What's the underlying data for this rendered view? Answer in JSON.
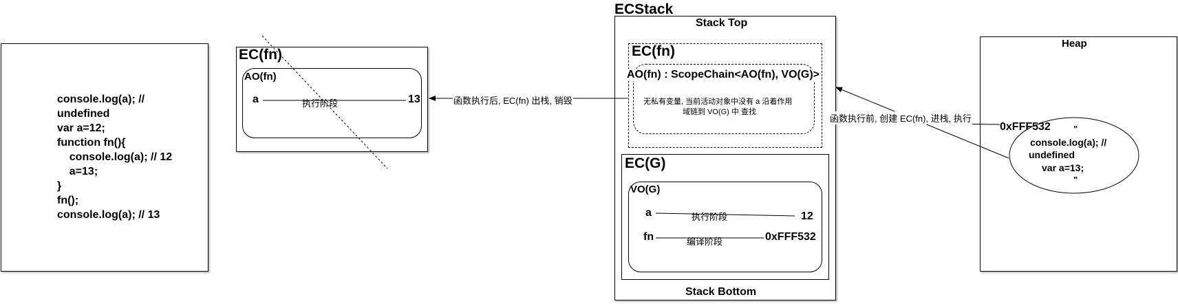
{
  "code_panel": {
    "lines": [
      "console.log(a); //",
      "undefined",
      "var a=12;",
      "function fn(){",
      "    console.log(a); // 12",
      "    a=13;",
      "}",
      "fn();",
      "console.log(a); // 13"
    ]
  },
  "popped_ec": {
    "title": "EC(fn)",
    "ao_title": "AO(fn)",
    "var_name": "a",
    "edge_label": "执行阶段",
    "value": "13"
  },
  "arrow_pop_label": "函数执行后, EC(fn) 出栈, 销毁",
  "ecstack": {
    "title": "ECStack",
    "top_label": "Stack Top",
    "bottom_label": "Stack Bottom",
    "ec_fn": {
      "title": "EC(fn)",
      "ao_title": "AO(fn) : ScopeChain<AO(fn), VO(G)>",
      "note_line1": "无私有变量, 当前活动对象中没有 a 沿着作用",
      "note_line2": "域链到 VO(G) 中 查找"
    },
    "ec_g": {
      "title": "EC(G)",
      "vo_title": "VO(G)",
      "row1": {
        "name": "a",
        "edge_label": "执行阶段",
        "value": "12"
      },
      "row2": {
        "name": "fn",
        "edge_label": "编译阶段",
        "value": "0xFFF532"
      }
    }
  },
  "arrow_push_label": "函数执行前, 创建 EC(fn),  进栈, 执行",
  "heap": {
    "title": "Heap",
    "address": "0xFFF532",
    "quote_open": "\"",
    "body_lines": [
      "console.log(a); //",
      "undefined",
      "var a=13;"
    ],
    "quote_close": "\""
  }
}
